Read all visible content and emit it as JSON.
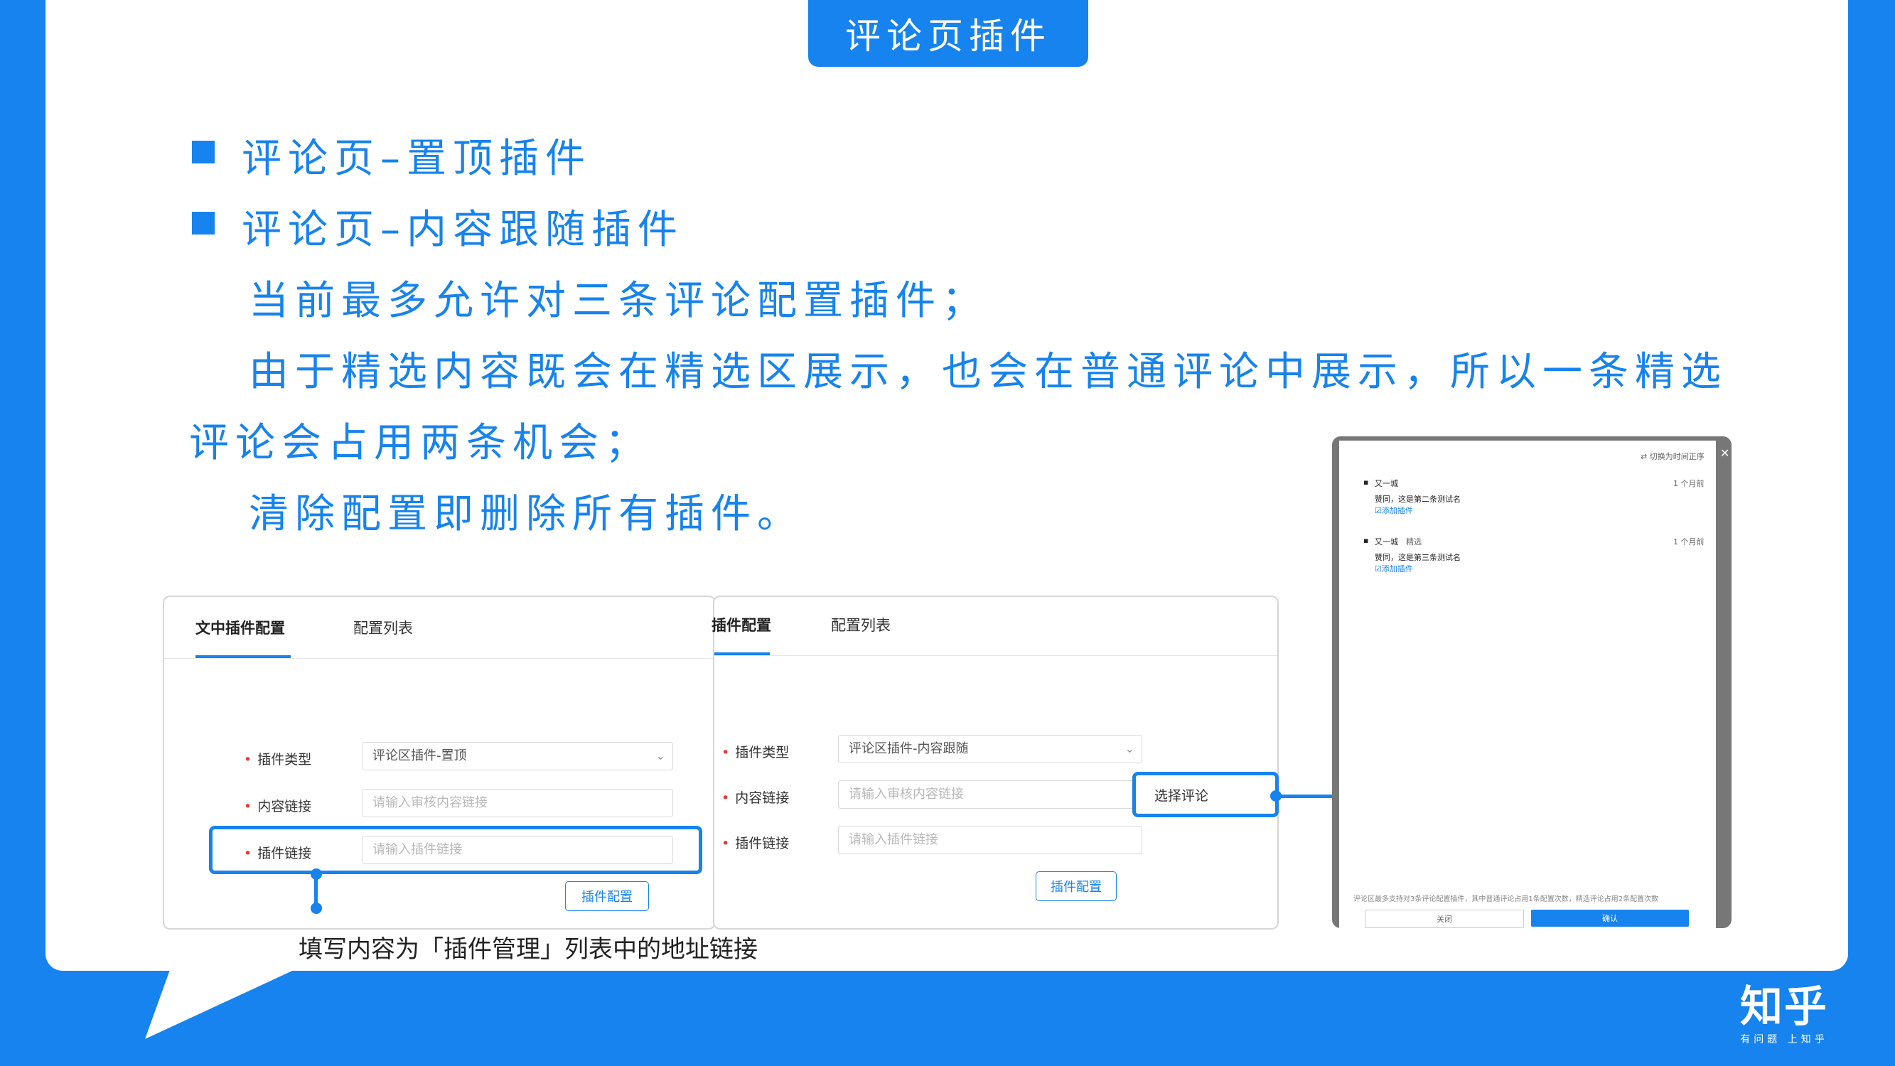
{
  "slide": {
    "title": "评论页插件",
    "bullets": [
      "评论页–置顶插件",
      "评论页–内容跟随插件"
    ],
    "paragraphs": [
      "当前最多允许对三条评论配置插件；",
      "由于精选内容既会在精选区展示，也会在普通评论中展示，所以一条精选",
      "评论会占用两条机会；",
      "清除配置即删除所有插件。"
    ],
    "annotation": "填写内容为「插件管理」列表中的地址链接"
  },
  "panel1": {
    "tab_active": "文中插件配置",
    "tab_other": "配置列表",
    "type_label": "插件类型",
    "type_value": "评论区插件-置顶",
    "content_label": "内容链接",
    "content_placeholder": "请输入审核内容链接",
    "link_label": "插件链接",
    "link_placeholder": "请输入插件链接",
    "config_button": "插件配置"
  },
  "panel2": {
    "tab_active": "插件配置",
    "tab_other": "配置列表",
    "type_label": "插件类型",
    "type_value": "评论区插件-内容跟随",
    "content_label": "内容链接",
    "content_placeholder": "请输入审核内容链接",
    "select_comment_button": "选择评论",
    "link_label": "插件链接",
    "link_placeholder": "请输入插件链接",
    "config_button": "插件配置"
  },
  "modal": {
    "sort_label": "⇄ 切换为时间正序",
    "comments": [
      {
        "user": "又一城",
        "tag": "",
        "time": "1 个月前",
        "text": "赞同，这是第二条测试名",
        "add": "添加插件"
      },
      {
        "user": "又一城",
        "tag": "精选",
        "time": "1 个月前",
        "text": "赞同，这是第三条测试名",
        "add": "添加插件"
      }
    ],
    "footer_note": "评论区最多支持对3条评论配置插件，其中普通评论占用1条配置次数，精选评论占用2条配置次数",
    "close_button": "关闭",
    "confirm_button": "确认"
  },
  "logo": {
    "main": "知乎",
    "sub": "有问题 上知乎"
  },
  "colors": {
    "brand_blue": "#1683ee",
    "white": "#ffffff"
  }
}
